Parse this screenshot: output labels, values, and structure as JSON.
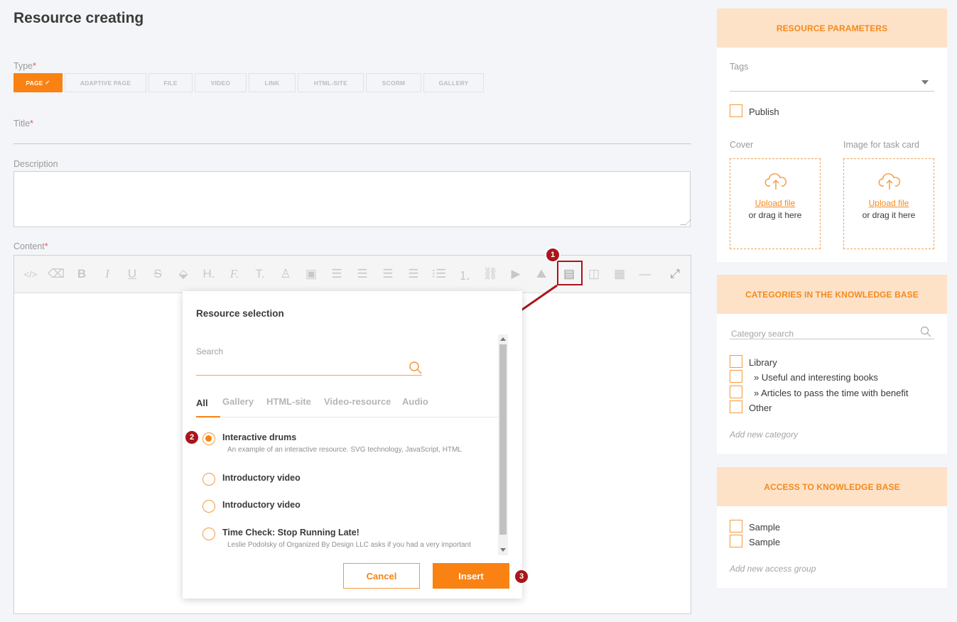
{
  "page_title": "Resource creating",
  "type_field": {
    "label": "Type",
    "required_mark": "*",
    "options": [
      "PAGE",
      "ADAPTIVE PAGE",
      "FILE",
      "VIDEO",
      "LINK",
      "HTML-SITE",
      "SCORM",
      "GALLERY"
    ],
    "selected_check": "✓"
  },
  "title_field": {
    "label": "Title",
    "required_mark": "*"
  },
  "description_field": {
    "label": "Description"
  },
  "content_field": {
    "label": "Content",
    "required_mark": "*"
  },
  "callouts": [
    "1",
    "2",
    "3"
  ],
  "modal": {
    "title": "Resource selection",
    "search_label": "Search",
    "tabs": [
      "All",
      "Gallery",
      "HTML-site",
      "Video-resource",
      "Audio"
    ],
    "items": [
      {
        "name": "Interactive drums",
        "description": "An example of an interactive resource. SVG technology, JavaScript, HTML",
        "checked": true
      },
      {
        "name": "Introductory video",
        "description": "",
        "checked": false
      },
      {
        "name": "Introductory video",
        "description": "",
        "checked": false
      },
      {
        "name": "Time Check: Stop Running Late!",
        "description": "Leslie Podolsky of Organized By Design LLC asks if you had a very important",
        "checked": false
      }
    ],
    "cancel_label": "Cancel",
    "insert_label": "Insert"
  },
  "resource_parameters": {
    "heading": "RESOURCE PARAMETERS",
    "tags_label": "Tags",
    "publish_label": "Publish",
    "cover_label": "Cover",
    "task_image_label": "Image for task card",
    "upload_link": "Upload file",
    "upload_hint": "or drag it here"
  },
  "categories": {
    "heading": "CATEGORIES IN THE KNOWLEDGE BASE",
    "search_placeholder": "Category search",
    "items": [
      "Library",
      "» Useful and interesting books",
      "» Articles to pass the time with benefit",
      "Other"
    ],
    "add_label": "Add new category"
  },
  "access": {
    "heading": "ACCESS TO KNOWLEDGE BASE",
    "items": [
      "Sample",
      "Sample"
    ],
    "add_label": "Add new access group"
  },
  "colors": {
    "accent": "#f98212",
    "panel_head_bg": "#fde2c8",
    "callout": "#a8161c"
  }
}
